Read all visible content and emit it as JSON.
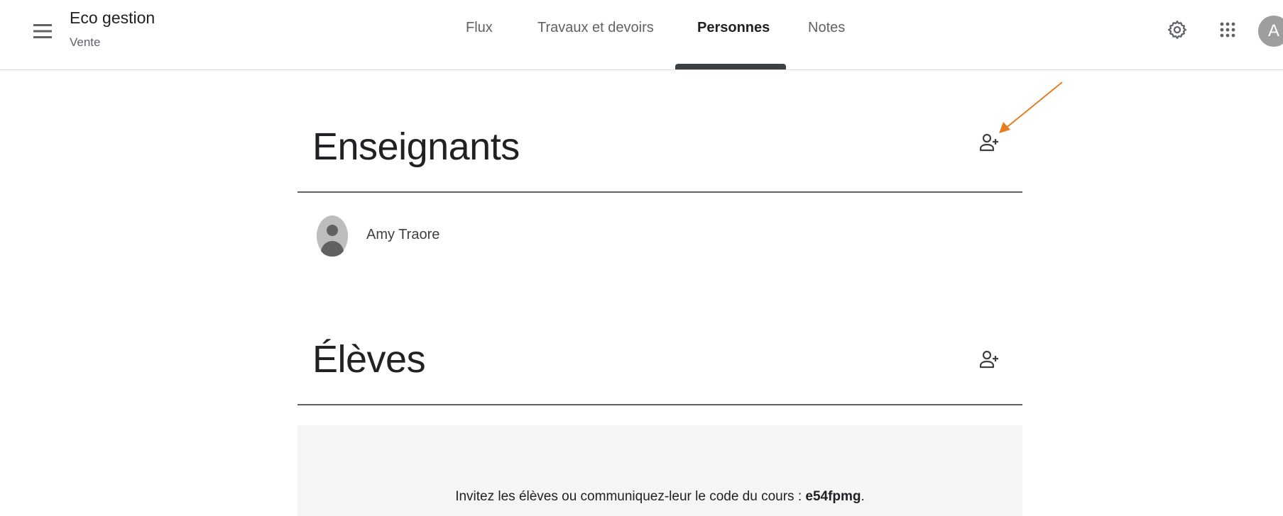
{
  "header": {
    "class_title": "Eco gestion",
    "class_subtitle": "Vente",
    "menu_icon": "hamburger-menu-icon",
    "settings_icon": "gear-icon",
    "apps_icon": "apps-grid-icon",
    "account_initial": "A"
  },
  "tabs": [
    {
      "label": "Flux",
      "active": false
    },
    {
      "label": "Travaux et devoirs",
      "active": false
    },
    {
      "label": "Personnes",
      "active": true
    },
    {
      "label": "Notes",
      "active": false
    }
  ],
  "teachers": {
    "title": "Enseignants",
    "add_icon": "add-person-icon",
    "people": [
      {
        "name": "Amy Traore"
      }
    ]
  },
  "students": {
    "title": "Élèves",
    "add_icon": "add-person-icon"
  },
  "invite": {
    "text": "Invitez les élèves ou communiquez-leur le code du cours : ",
    "code": "e54fpmg",
    "suffix": "."
  },
  "annotation": {
    "color": "#e67e22",
    "icon": "arrow-annotation"
  },
  "colors": {
    "text_primary": "#202124",
    "text_secondary": "#5f6368",
    "divider": "#5f6368"
  }
}
